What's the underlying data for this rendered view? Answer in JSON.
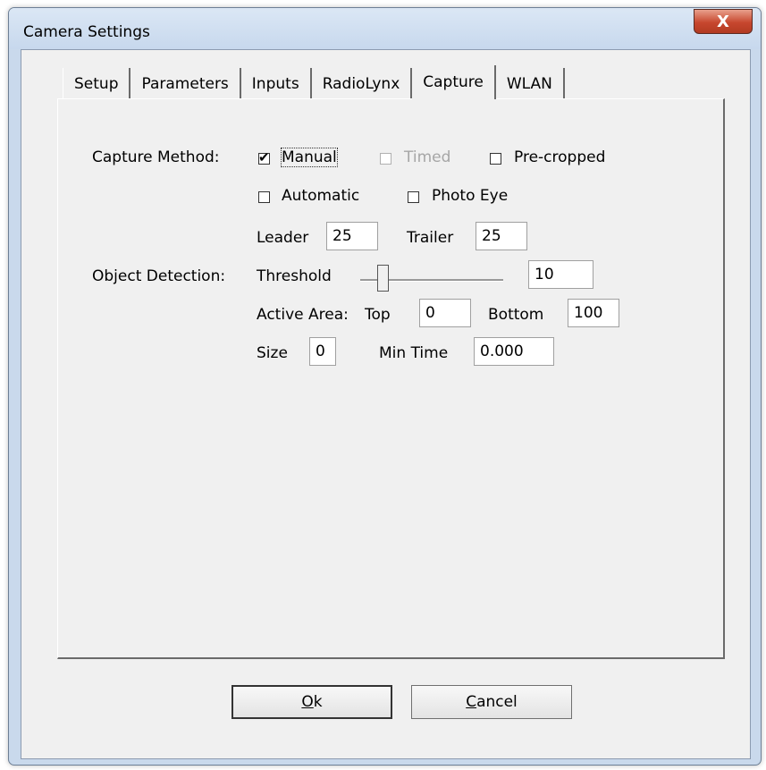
{
  "window": {
    "title": "Camera Settings",
    "close_label": "X"
  },
  "tabs": [
    {
      "label": "Setup"
    },
    {
      "label": "Parameters"
    },
    {
      "label": "Inputs"
    },
    {
      "label": "RadioLynx"
    },
    {
      "label": "Capture",
      "active": true
    },
    {
      "label": "WLAN"
    }
  ],
  "capture": {
    "method_label": "Capture Method:",
    "manual": {
      "label": "Manual",
      "checked": true
    },
    "timed": {
      "label": "Timed",
      "checked": false,
      "disabled": true
    },
    "precropped": {
      "label": "Pre-cropped",
      "checked": false
    },
    "automatic": {
      "label": "Automatic",
      "checked": false
    },
    "photo_eye": {
      "label": "Photo Eye",
      "checked": false
    },
    "leader_label": "Leader",
    "leader_value": "25",
    "trailer_label": "Trailer",
    "trailer_value": "25"
  },
  "detection": {
    "label": "Object Detection:",
    "threshold_label": "Threshold",
    "threshold_value": "10",
    "active_area_label": "Active Area:",
    "top_label": "Top",
    "top_value": "0",
    "bottom_label": "Bottom",
    "bottom_value": "100",
    "size_label": "Size",
    "size_value": "0",
    "min_time_label": "Min Time",
    "min_time_value": "0.000"
  },
  "buttons": {
    "ok_mnemonic": "O",
    "ok_rest": "k",
    "cancel_mnemonic": "C",
    "cancel_rest": "ancel"
  }
}
